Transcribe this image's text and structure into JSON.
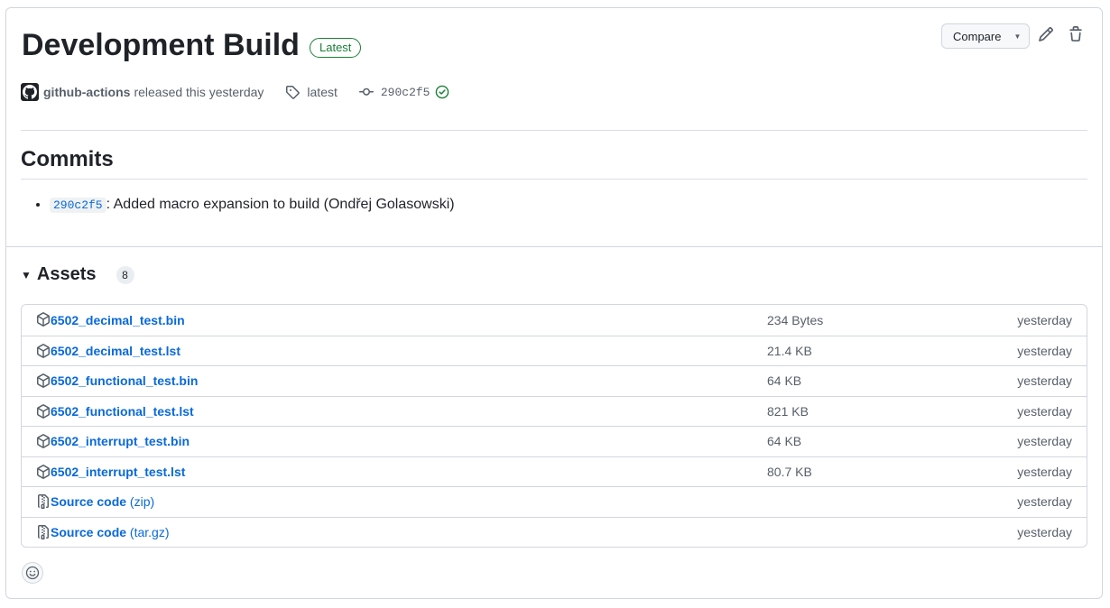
{
  "release": {
    "title": "Development Build",
    "badge": "Latest",
    "author": "github-actions",
    "released_text": "released this yesterday",
    "tag": "latest",
    "commit_sha": "290c2f5"
  },
  "actions": {
    "compare_label": "Compare"
  },
  "commits": {
    "heading": "Commits",
    "items": [
      {
        "sha": "290c2f5",
        "message": ": Added macro expansion to build (Ondřej Golasowski)"
      }
    ]
  },
  "assets": {
    "heading": "Assets",
    "count": "8",
    "items": [
      {
        "name": "6502_decimal_test.bin",
        "suffix": "",
        "size": "234 Bytes",
        "time": "yesterday",
        "icon": "package-icon"
      },
      {
        "name": "6502_decimal_test.lst",
        "suffix": "",
        "size": "21.4 KB",
        "time": "yesterday",
        "icon": "package-icon"
      },
      {
        "name": "6502_functional_test.bin",
        "suffix": "",
        "size": "64 KB",
        "time": "yesterday",
        "icon": "package-icon"
      },
      {
        "name": "6502_functional_test.lst",
        "suffix": "",
        "size": "821 KB",
        "time": "yesterday",
        "icon": "package-icon"
      },
      {
        "name": "6502_interrupt_test.bin",
        "suffix": "",
        "size": "64 KB",
        "time": "yesterday",
        "icon": "package-icon"
      },
      {
        "name": "6502_interrupt_test.lst",
        "suffix": "",
        "size": "80.7 KB",
        "time": "yesterday",
        "icon": "package-icon"
      },
      {
        "name": "Source code",
        "suffix": " (zip)",
        "size": "",
        "time": "yesterday",
        "icon": "file-zip-icon"
      },
      {
        "name": "Source code",
        "suffix": " (tar.gz)",
        "size": "",
        "time": "yesterday",
        "icon": "file-zip-icon"
      }
    ]
  },
  "colors": {
    "link": "#0969da",
    "success": "#1a7f37",
    "muted": "#57606a",
    "border": "#d0d7de"
  }
}
